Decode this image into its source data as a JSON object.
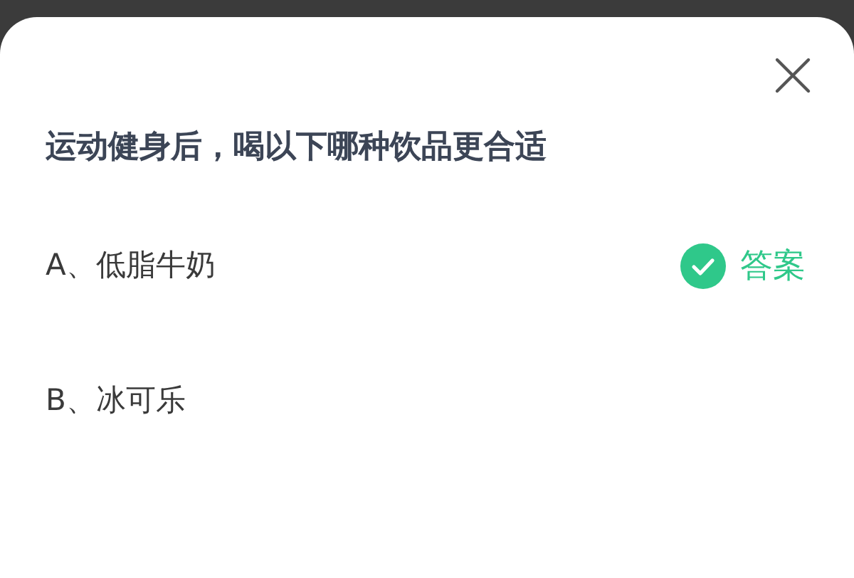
{
  "question": "运动健身后，喝以下哪种饮品更合适",
  "answer_label": "答案",
  "options": [
    {
      "label": "A、低脂牛奶",
      "selected": true
    },
    {
      "label": "B、冰可乐",
      "selected": false
    }
  ]
}
